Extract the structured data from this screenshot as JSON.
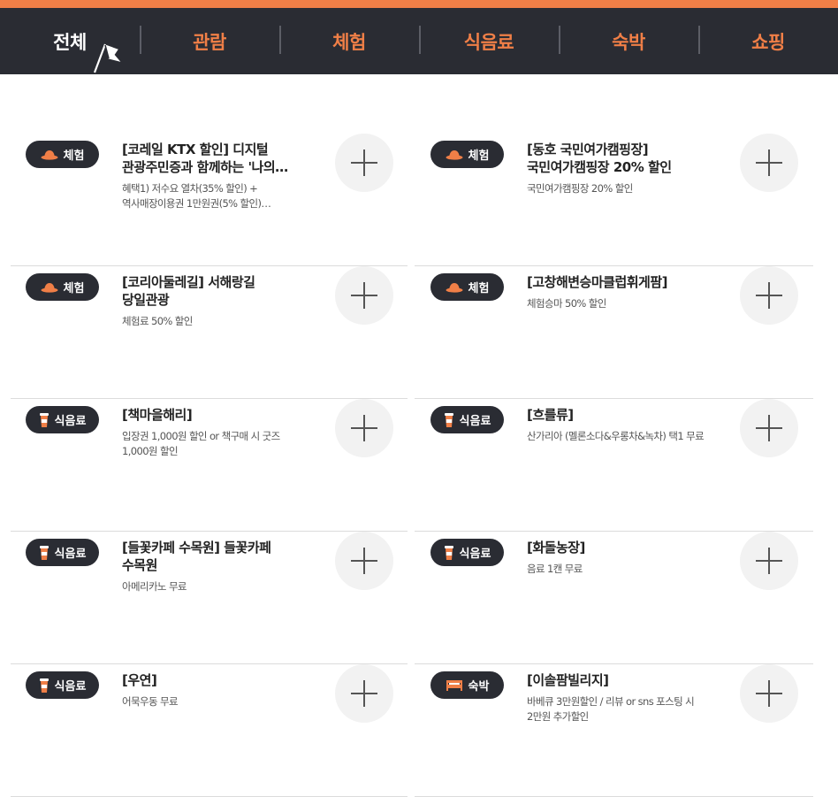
{
  "nav": {
    "tabs": [
      {
        "label": "전체",
        "active": true
      },
      {
        "label": "관람",
        "active": false
      },
      {
        "label": "체험",
        "active": false
      },
      {
        "label": "식음료",
        "active": false
      },
      {
        "label": "숙박",
        "active": false
      },
      {
        "label": "쇼핑",
        "active": false
      }
    ]
  },
  "items": [
    {
      "category": "체험",
      "icon": "hat-icon",
      "title": "[코레일 KTX 할인] 디지털 관광주민증과 함께하는 '나의…",
      "title_lines": [
        "[코레일 KTX 할인] 디지털",
        "관광주민증과 함께하는 '나의…"
      ],
      "desc_lines": [
        "혜택1) 저수요 열차(35% 할인) +",
        "역사매장이용권 1만원권(5% 할인)…"
      ]
    },
    {
      "category": "체험",
      "icon": "hat-icon",
      "title_lines": [
        "[동호 국민여가캠핑장]",
        "국민여가캠핑장 20% 할인"
      ],
      "desc_lines": [
        "국민여가캠핑장 20% 할인"
      ]
    },
    {
      "category": "체험",
      "icon": "hat-icon",
      "title_lines": [
        "[코리아둘레길] 서해랑길",
        "당일관광"
      ],
      "desc_lines": [
        "체험료 50% 할인"
      ]
    },
    {
      "category": "체험",
      "icon": "hat-icon",
      "title_lines": [
        "[고창해변승마클럽휘게팜]"
      ],
      "desc_lines": [
        "체험승마 50% 할인"
      ]
    },
    {
      "category": "식음료",
      "icon": "cup-icon",
      "title_lines": [
        "[책마을해리]"
      ],
      "desc_lines": [
        "입장권 1,000원 할인 or 책구매 시 굿즈",
        "1,000원 할인"
      ]
    },
    {
      "category": "식음료",
      "icon": "cup-icon",
      "title_lines": [
        "[흐를류]"
      ],
      "desc_lines": [
        "산가리아 (멜론소다&우롱차&녹차) 택1 무료"
      ]
    },
    {
      "category": "식음료",
      "icon": "cup-icon",
      "title_lines": [
        "[들꽃카페 수목원] 들꽃카페",
        "수목원"
      ],
      "desc_lines": [
        "아메리카노 무료"
      ]
    },
    {
      "category": "식음료",
      "icon": "cup-icon",
      "title_lines": [
        "[화돌농장]"
      ],
      "desc_lines": [
        "음료 1캔 무료"
      ]
    },
    {
      "category": "식음료",
      "icon": "cup-icon",
      "title_lines": [
        "[우연]"
      ],
      "desc_lines": [
        "어묵우동 무료"
      ]
    },
    {
      "category": "숙박",
      "icon": "bed-icon",
      "title_lines": [
        "[이솔팜빌리지]"
      ],
      "desc_lines": [
        "바베큐 3만원할인 / 리뷰 or sns 포스팅 시",
        "2만원 추가할인"
      ]
    }
  ],
  "colors": {
    "accent": "#f07f47",
    "nav_bg": "#2a2c33",
    "badge_bg": "#2a2c33",
    "plus_bg": "#f2f2f2"
  }
}
